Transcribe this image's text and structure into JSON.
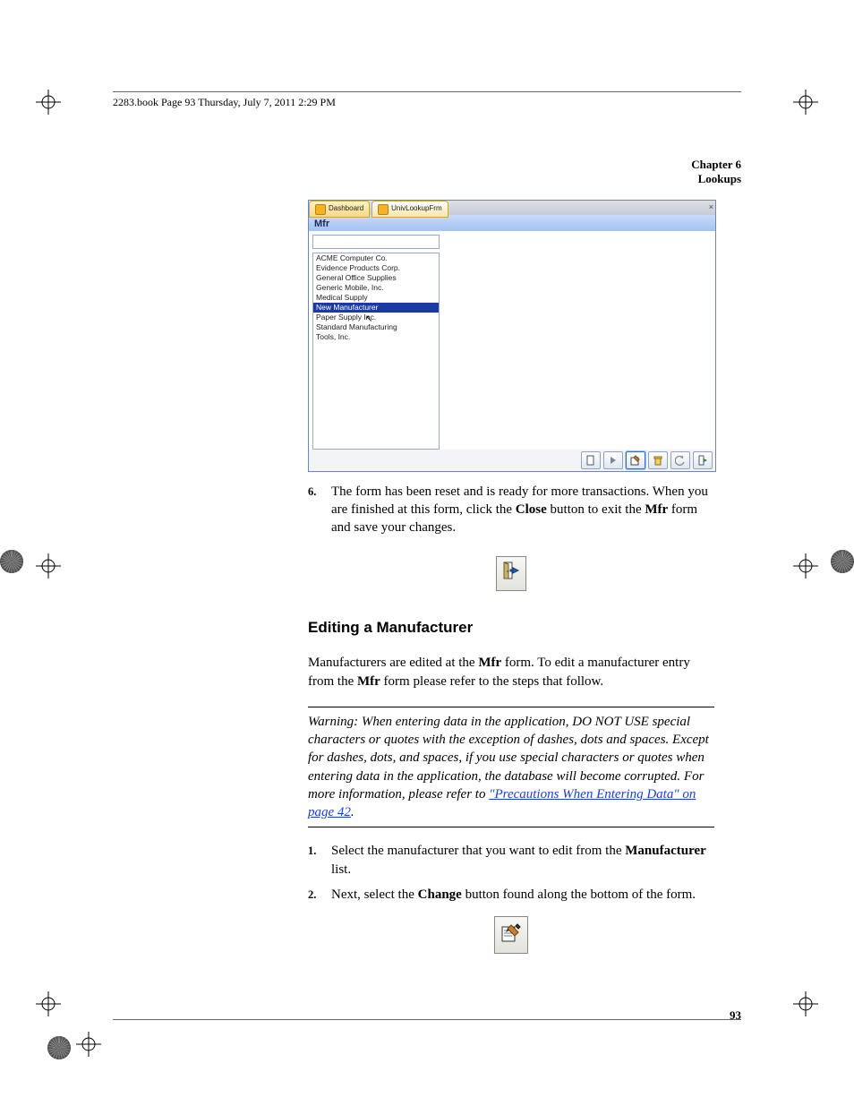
{
  "running_head": "2283.book  Page 93  Thursday, July 7, 2011  2:29 PM",
  "chapter_line1": "Chapter 6",
  "chapter_line2": "Lookups",
  "screenshot": {
    "tab1": "Dashboard",
    "tab2": "UnivLookupFrm",
    "title": "Mfr",
    "close": "×",
    "list": [
      "ACME Computer Co.",
      "Evidence Products Corp.",
      "General Office Supplies",
      "Generic Mobile, Inc.",
      "Medical Supply",
      "New Manufacturer",
      "Paper Supply Inc.",
      "Standard Manufacturing",
      "Tools, Inc."
    ],
    "selected_index": 5
  },
  "step6_num": "6.",
  "step6_a": "The form has been reset and is ready for more transactions. When you are finished at this form, click the ",
  "step6_b": "Close",
  "step6_c": " button to exit the ",
  "step6_d": "Mfr",
  "step6_e": " form and save your changes.",
  "section_heading": "Editing a Manufacturer",
  "para1_a": "Manufacturers are edited at the ",
  "para1_b": "Mfr",
  "para1_c": " form. To edit a manufacturer entry from the ",
  "para1_d": "Mfr",
  "para1_e": " form please refer to the steps that follow.",
  "warn_prefix": "Warning:   ",
  "warn_body": "When entering data in the application, DO NOT USE special characters or quotes with the exception of dashes, dots and spaces. Except for dashes, dots, and spaces, if you use special characters or quotes when entering data in the application, the database will become corrupted. For more information, please refer to ",
  "warn_link": "\"Precautions When Entering Data\" on page 42",
  "warn_period": ".",
  "steps": {
    "s1_num": "1.",
    "s1_a": "Select the manufacturer that you want to edit from the ",
    "s1_b": "Manufacturer",
    "s1_c": " list.",
    "s2_num": "2.",
    "s2_a": "Next, select the ",
    "s2_b": "Change",
    "s2_c": " button found along the bottom of the form."
  },
  "page_number": "93"
}
